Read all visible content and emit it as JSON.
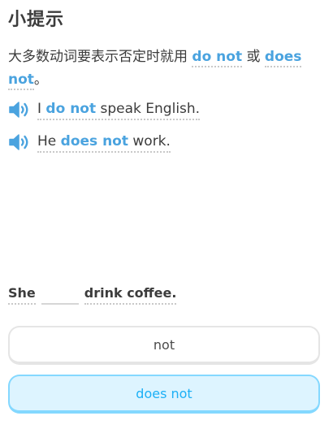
{
  "tip": {
    "title": "小提示",
    "body_prefix": "大多数动词要表示否定时就用 ",
    "keyword1": "do not",
    "connector": " 或 ",
    "keyword2": "does not",
    "body_suffix": "。"
  },
  "examples": [
    {
      "icon": "speaker-icon",
      "before": "I ",
      "keyword": "do not",
      "after": " speak English."
    },
    {
      "icon": "speaker-icon",
      "before": "He ",
      "keyword": "does not",
      "after": " work."
    }
  ],
  "exercise": {
    "word_before": "She",
    "word_after": "drink coffee."
  },
  "choices": [
    {
      "label": "not",
      "selected": false
    },
    {
      "label": "does not",
      "selected": true
    }
  ],
  "colors": {
    "keyword": "#4aa3df",
    "selected_bg": "#ddf4ff",
    "selected_border": "#84d8ff",
    "selected_text": "#1cb0f6"
  }
}
